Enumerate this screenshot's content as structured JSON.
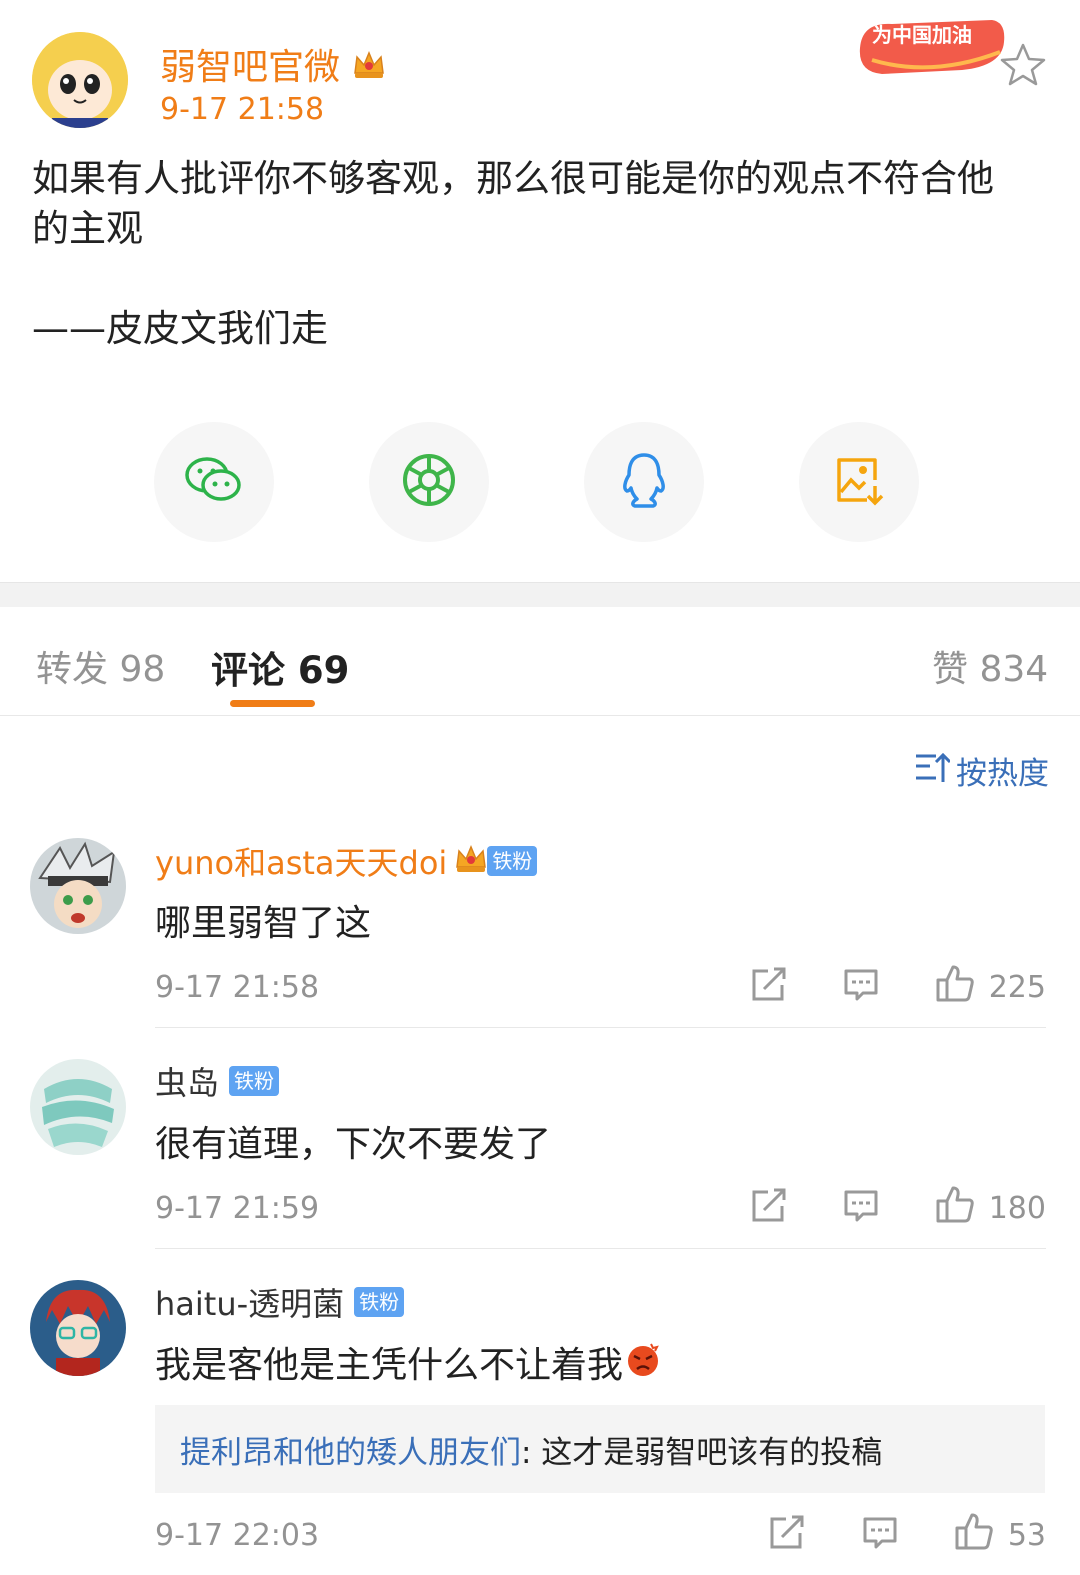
{
  "post": {
    "author": "弱智吧官微",
    "time": "9-17 21:58",
    "text_line1": "如果有人批评你不够客观，那么很可能是你的观点不符合他",
    "text_line2": "的主观",
    "signature": "——皮皮文我们走",
    "banner_text": "为中国加油"
  },
  "share": {
    "items": [
      "wechat-icon",
      "moments-icon",
      "qq-icon",
      "save-image-icon"
    ]
  },
  "tabs": {
    "repost": "转发 98",
    "comments": "评论 69",
    "likes": "赞 834"
  },
  "sort": {
    "label": "按热度"
  },
  "comments": [
    {
      "name": "yuno和asta天天doi",
      "badge": "铁粉",
      "text": "哪里弱智了这",
      "time": "9-17 21:58",
      "likes": "225"
    },
    {
      "name": "虫岛",
      "badge": "铁粉",
      "text": "很有道理，下次不要发了",
      "time": "9-17 21:59",
      "likes": "180"
    },
    {
      "name": "haitu-透明菌",
      "badge": "铁粉",
      "text": "我是客他是主凭什么不让着我",
      "time": "9-17 22:03",
      "likes": "53",
      "reply_user": "提利昂和他的矮人朋友们",
      "reply_text": ": 这才是弱智吧该有的投稿"
    }
  ],
  "colors": {
    "accent": "#f07d17",
    "link": "#3a6fb8",
    "badge": "#5ea3f2"
  }
}
